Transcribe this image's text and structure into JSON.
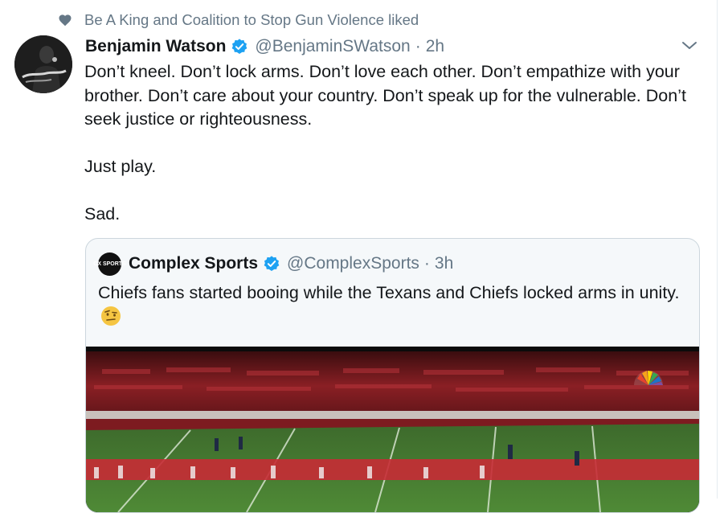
{
  "social_context": {
    "text": "Be A King and Coalition to Stop Gun Violence liked",
    "icon": "heart-icon"
  },
  "tweet": {
    "author_name": "Benjamin Watson",
    "handle": "@BenjaminSWatson",
    "separator": "·",
    "time": "2h",
    "verified": true,
    "paragraphs": [
      "Don’t kneel. Don’t lock arms. Don’t love each other. Don’t empathize with your brother. Don’t care about your country. Don’t speak up for the vulnerable. Don’t seek justice or righteousness.",
      "Just play.",
      "Sad."
    ]
  },
  "quoted_tweet": {
    "logo_text": "CX SPORTS",
    "author_name": "Complex Sports",
    "handle": "@ComplexSports",
    "separator": "·",
    "time": "3h",
    "verified": true,
    "text": "Chiefs fans started booing while the Texans and Chiefs locked arms in unity.",
    "emoji": "raised-eyebrow-emoji"
  },
  "colors": {
    "text_primary": "#14171a",
    "text_secondary": "#657786",
    "verified_blue": "#1da1f2",
    "border": "#ccd6dd"
  }
}
